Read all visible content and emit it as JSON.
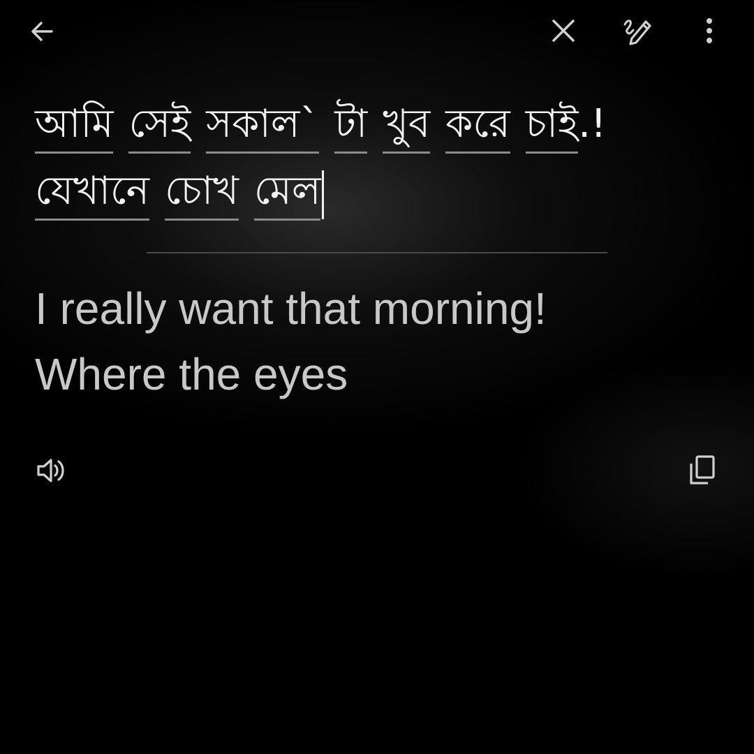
{
  "toolbar": {
    "back_icon": "arrow-left-icon",
    "close_icon": "close-icon",
    "handwriting_icon": "handwriting-pen-icon",
    "more_icon": "more-vertical-icon"
  },
  "source": {
    "line1": [
      "আমি",
      "সেই",
      "সকাল`",
      "টা",
      "খুব",
      "করে",
      "চাই"
    ],
    "line1_end_punct": ".!",
    "line2": [
      "যেখানে",
      "চোখ",
      "মেল"
    ]
  },
  "translation": {
    "line1": "I really want that morning!",
    "line2": "Where the eyes"
  },
  "actions": {
    "speaker_icon": "speaker-icon",
    "copy_icon": "copy-icon"
  },
  "colors": {
    "background": "#000000",
    "source_text": "#f2f2f2",
    "translation_text": "#c8c8c8",
    "icon": "#d0d0d0"
  }
}
